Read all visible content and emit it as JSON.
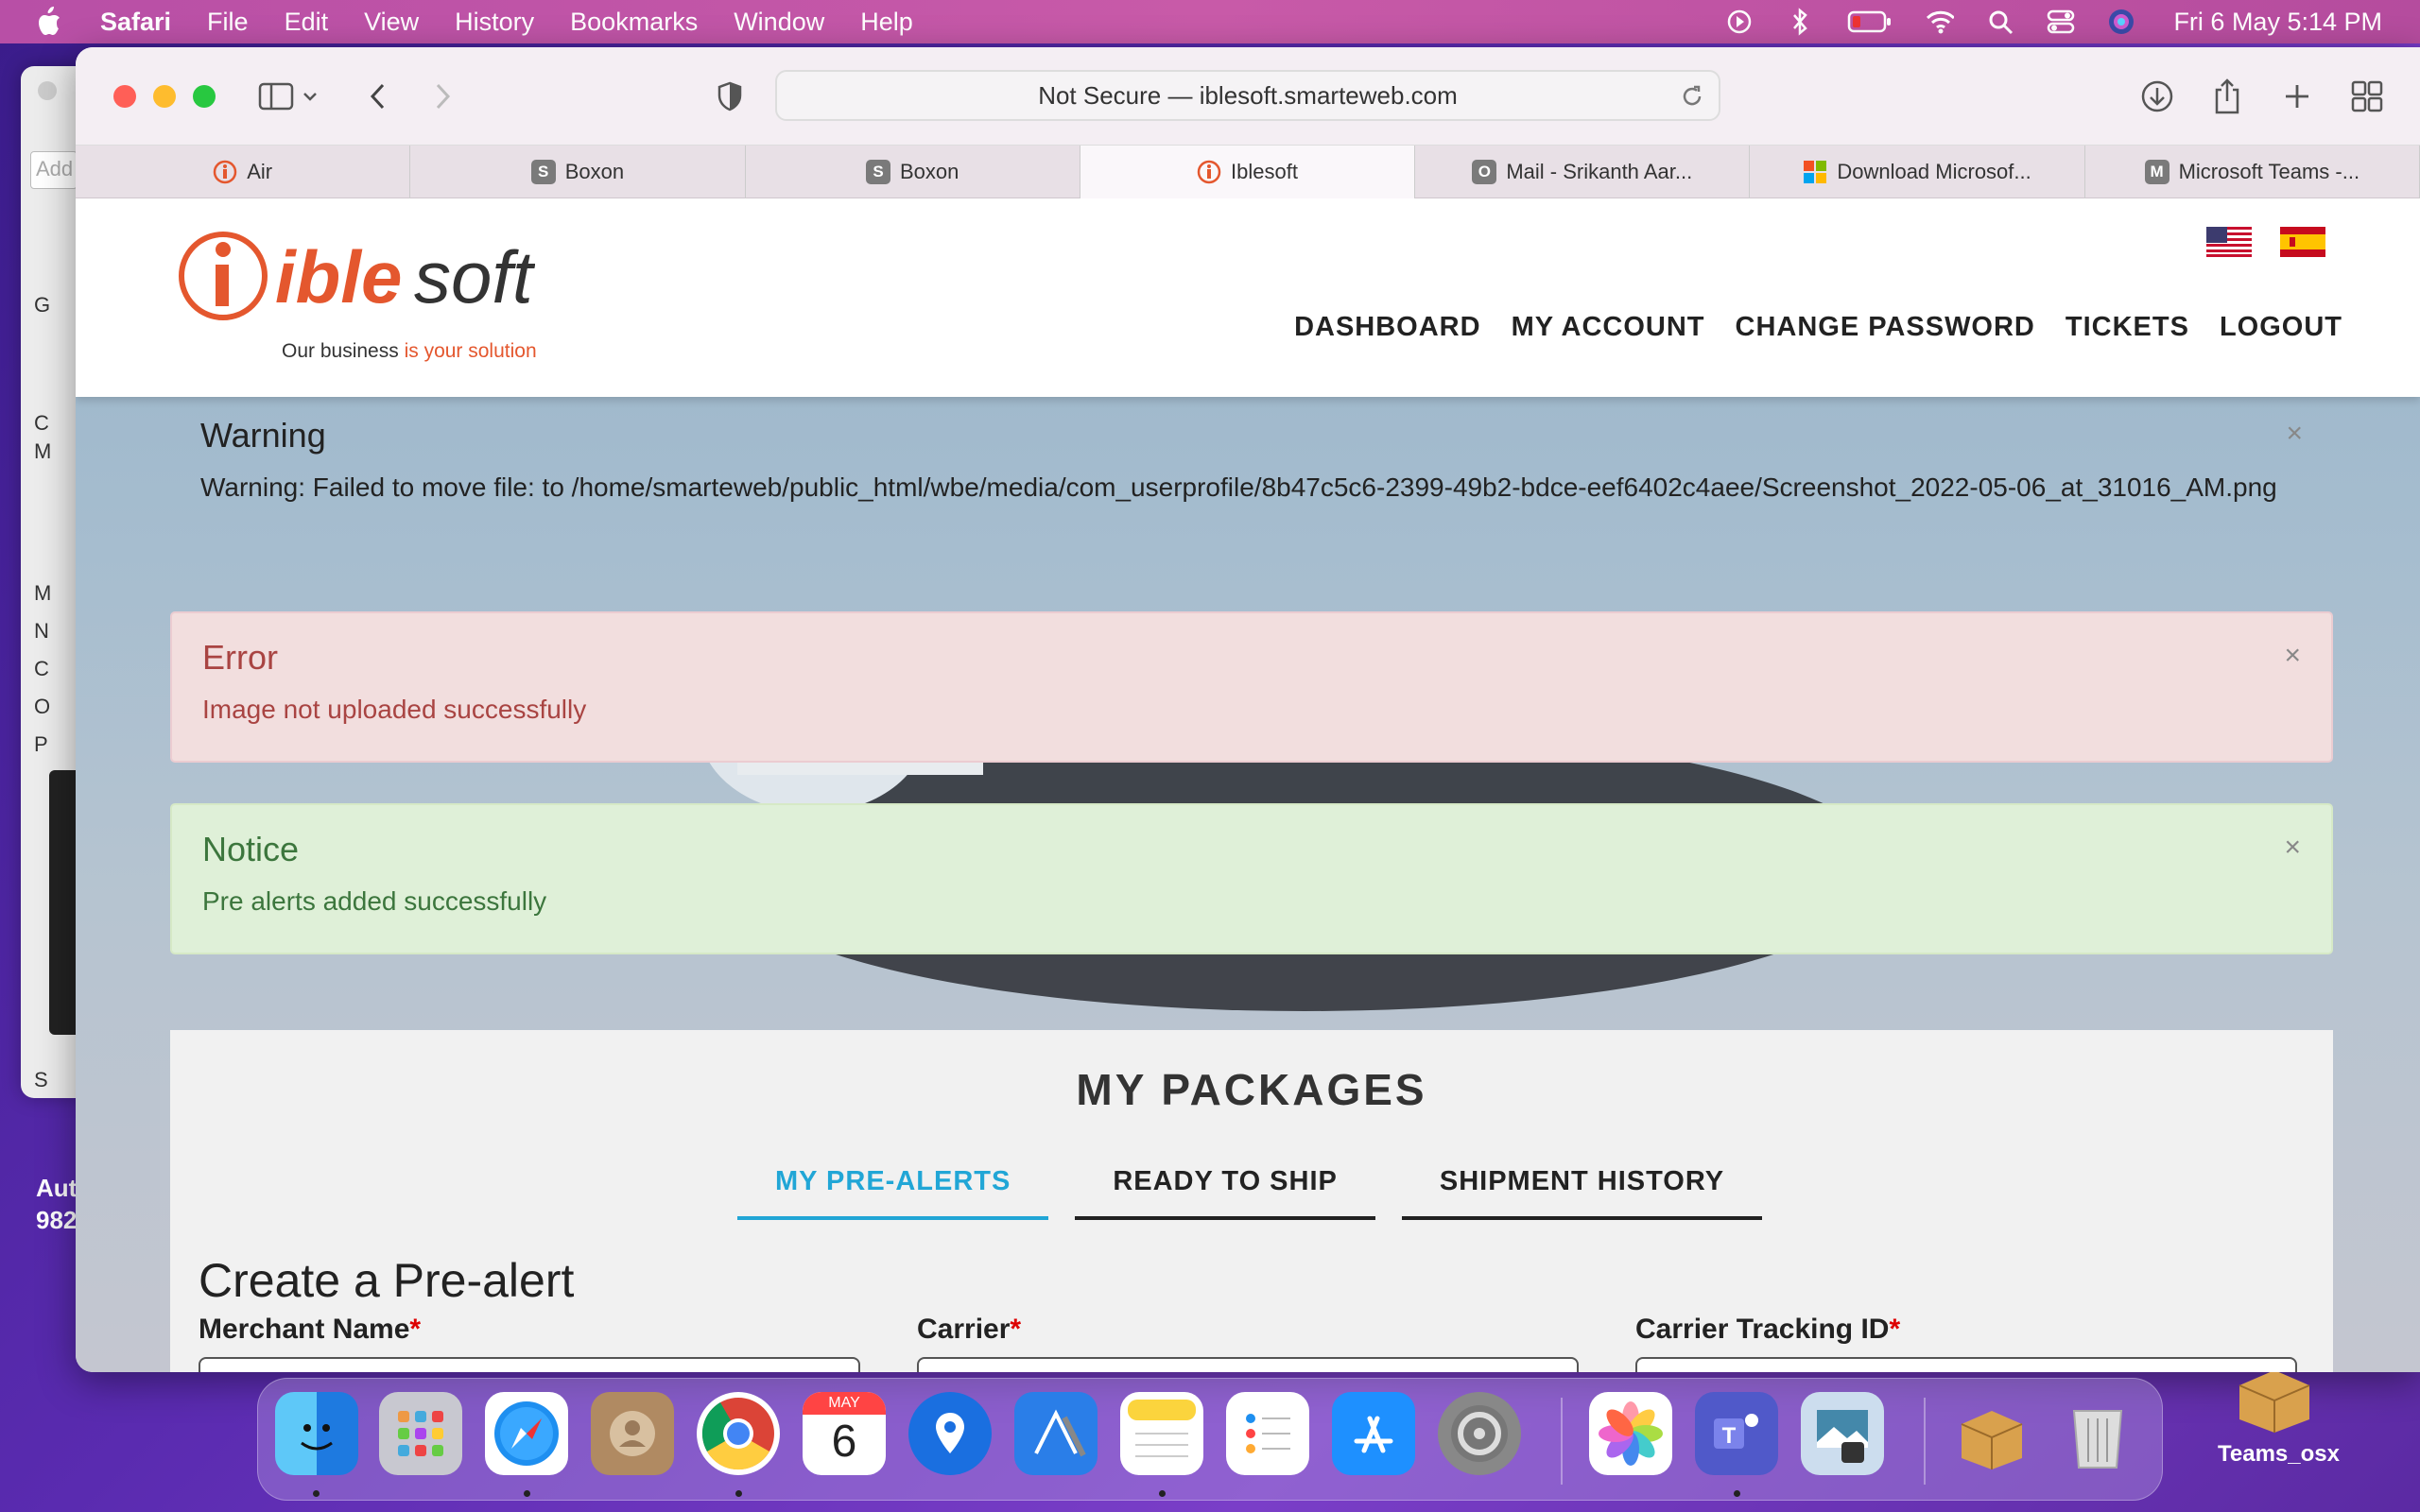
{
  "menubar": {
    "items": [
      "Safari",
      "File",
      "Edit",
      "View",
      "History",
      "Bookmarks",
      "Window",
      "Help"
    ],
    "clock": "Fri 6 May  5:14 PM"
  },
  "safari": {
    "url": "Not Secure — iblesoft.smarteweb.com",
    "tabs": [
      {
        "label": "Air",
        "fav": "i",
        "color": "#e4572e"
      },
      {
        "label": "Boxon",
        "fav": "S",
        "color": "#7a7a7a"
      },
      {
        "label": "Boxon",
        "fav": "S",
        "color": "#7a7a7a"
      },
      {
        "label": "Iblesoft",
        "fav": "i",
        "color": "#e4572e"
      },
      {
        "label": "Mail - Srikanth Aar...",
        "fav": "O",
        "color": "#7a7a7a"
      },
      {
        "label": "Download Microsof...",
        "fav": "ms",
        "color": "#f25022"
      },
      {
        "label": "Microsoft Teams -...",
        "fav": "M",
        "color": "#7a7a7a"
      }
    ],
    "active_tab": 3
  },
  "site": {
    "logo_text": "iblesoft",
    "tagline_a": "Our business ",
    "tagline_b": "is your solution",
    "nav": [
      "DASHBOARD",
      "MY ACCOUNT",
      "CHANGE PASSWORD",
      "TICKETS",
      "LOGOUT"
    ]
  },
  "alerts": {
    "warning": {
      "title": "Warning",
      "body": "Warning: Failed to move file: to /home/smarteweb/public_html/wbe/media/com_userprofile/8b47c5c6-2399-49b2-bdce-eef6402c4aee/Screenshot_2022-05-06_at_31016_AM.png"
    },
    "error": {
      "title": "Error",
      "body": "Image not uploaded successfully"
    },
    "notice": {
      "title": "Notice",
      "body": "Pre alerts added successfully"
    },
    "close": "×"
  },
  "packages": {
    "title": "MY PACKAGES",
    "tabs": [
      "MY PRE-ALERTS",
      "READY TO SHIP",
      "SHIPMENT HISTORY"
    ],
    "form_title": "Create a Pre-alert",
    "fields": [
      "Merchant Name",
      "Carrier",
      "Carrier Tracking ID"
    ],
    "required_mark": "*"
  },
  "dock": {
    "calendar_month": "MAY",
    "calendar_day": "6",
    "teams_osx_label": "Teams_osx"
  },
  "background_window": {
    "search_placeholder": "Add",
    "rows": [
      "G",
      "C",
      "M",
      "M",
      "N",
      "C",
      "O",
      "P",
      "S"
    ],
    "desktop_text": [
      "Aut",
      "982"
    ]
  }
}
